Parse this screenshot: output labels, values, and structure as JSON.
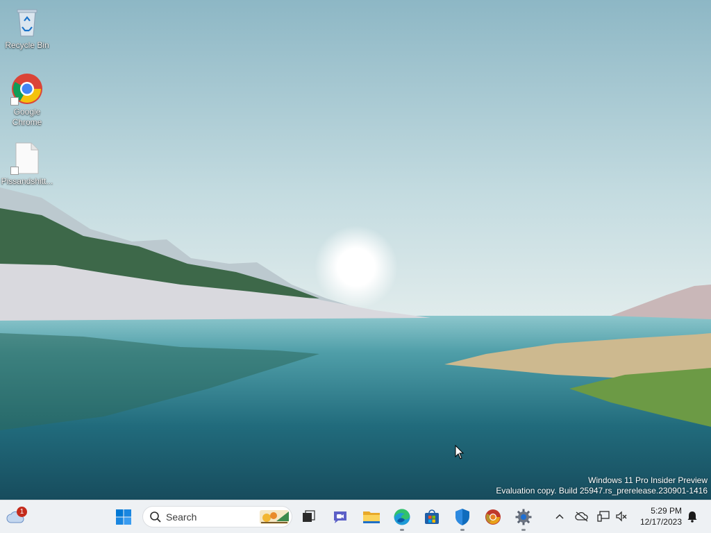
{
  "desktop": {
    "icons": [
      {
        "label": "Recycle Bin",
        "icon": "recycle-bin-icon"
      },
      {
        "label": "Google Chrome",
        "icon": "chrome-icon"
      },
      {
        "label": "Pissandshitt...",
        "icon": "file-icon"
      }
    ],
    "watermark": {
      "line1": "Windows 11 Pro Insider Preview",
      "line2": "Evaluation copy. Build 25947.rs_prerelease.230901-1416"
    }
  },
  "taskbar": {
    "weather": {
      "badge": "1",
      "icon": "weather-cloud-icon"
    },
    "search": {
      "label": "Search",
      "icon": "search-icon"
    },
    "apps": [
      {
        "name": "start",
        "icon": "windows-start-icon"
      },
      {
        "name": "task-view",
        "icon": "task-view-icon"
      },
      {
        "name": "teams-chat",
        "icon": "chat-icon"
      },
      {
        "name": "file-explorer",
        "icon": "folder-icon"
      },
      {
        "name": "edge",
        "icon": "edge-icon"
      },
      {
        "name": "microsoft-store",
        "icon": "store-icon"
      },
      {
        "name": "windows-security",
        "icon": "shield-icon"
      },
      {
        "name": "chrome",
        "icon": "chrome-icon"
      },
      {
        "name": "settings",
        "icon": "gear-icon"
      }
    ],
    "tray": {
      "icons": [
        "chevron-up-icon",
        "onedrive-offline-icon",
        "network-icon",
        "volume-muted-icon"
      ],
      "time": "5:29 PM",
      "date": "12/17/2023",
      "notifications_icon": "bell-icon"
    }
  },
  "colors": {
    "taskbar_bg": "#eef1f4",
    "accent": "#0067c0",
    "badge": "#c42b1c"
  }
}
